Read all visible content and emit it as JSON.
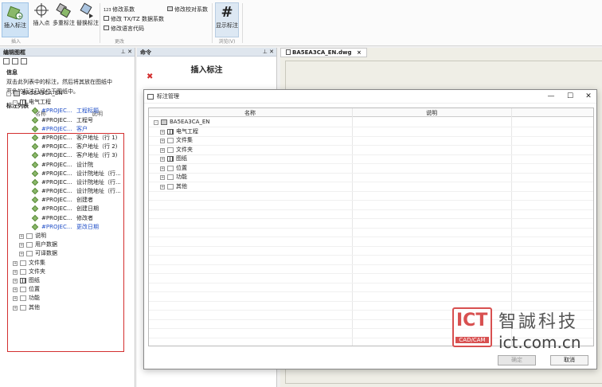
{
  "ribbon": {
    "insert_group": {
      "buttons": [
        {
          "label": "插入标注",
          "icon": "insert-tag-icon"
        },
        {
          "label": "插入点",
          "icon": "crosshair-icon"
        },
        {
          "label": "多重标注",
          "icon": "multi-tag-icon"
        },
        {
          "label": "替换标注",
          "icon": "replace-tag-icon"
        }
      ],
      "group_label": "插入"
    },
    "modify_group": {
      "items": [
        "修改系数",
        "修改 TX/TZ 数据系数",
        "修改语言代码",
        "修改校对系数"
      ],
      "group_label": "更改"
    },
    "browse_group": {
      "button_label": "显示标注",
      "group_label": "浏览(V)"
    }
  },
  "left_panel": {
    "title": "编辑图框",
    "info_title": "信息",
    "info_lines": [
      "双击此列表中的标注，然后将其放在图纸中",
      "蓝色的标注已经位于图纸中。"
    ],
    "list_title": "标注列表",
    "columns": {
      "name": "名称",
      "desc": "说明"
    },
    "tree": [
      {
        "label": "BA5EA3CA_EN",
        "depth": 0,
        "icon": "db",
        "expand": "-"
      },
      {
        "label": "电气工程",
        "depth": 1,
        "icon": "grid",
        "expand": "-"
      },
      {
        "label": "#PROJEC...",
        "desc": "工程标题",
        "depth": 3,
        "icon": "tag",
        "blue": true
      },
      {
        "label": "#PROJEC...",
        "desc": "工程号",
        "depth": 3,
        "icon": "tag"
      },
      {
        "label": "#PROJEC...",
        "desc": "客户",
        "depth": 3,
        "icon": "tag",
        "blue": true
      },
      {
        "label": "#PROJEC...",
        "desc": "客户地址（行 1)",
        "depth": 3,
        "icon": "tag"
      },
      {
        "label": "#PROJEC...",
        "desc": "客户地址（行 2)",
        "depth": 3,
        "icon": "tag"
      },
      {
        "label": "#PROJEC...",
        "desc": "客户地址（行 3)",
        "depth": 3,
        "icon": "tag"
      },
      {
        "label": "#PROJEC...",
        "desc": "设计院",
        "depth": 3,
        "icon": "tag"
      },
      {
        "label": "#PROJEC...",
        "desc": "设计院地址（行...",
        "depth": 3,
        "icon": "tag"
      },
      {
        "label": "#PROJEC...",
        "desc": "设计院地址（行...",
        "depth": 3,
        "icon": "tag"
      },
      {
        "label": "#PROJEC...",
        "desc": "设计院地址（行...",
        "depth": 3,
        "icon": "tag"
      },
      {
        "label": "#PROJEC...",
        "desc": "创建者",
        "depth": 3,
        "icon": "tag"
      },
      {
        "label": "#PROJEC...",
        "desc": "创建日期",
        "depth": 3,
        "icon": "tag"
      },
      {
        "label": "#PROJEC...",
        "desc": "修改者",
        "depth": 3,
        "icon": "tag"
      },
      {
        "label": "#PROJEC...",
        "desc": "更改日期",
        "depth": 3,
        "icon": "tag",
        "blue": true
      },
      {
        "label": "说明",
        "depth": 2,
        "icon": "folder",
        "expand": "+"
      },
      {
        "label": "用户数据",
        "depth": 2,
        "icon": "folder",
        "expand": "+"
      },
      {
        "label": "可译数据",
        "depth": 2,
        "icon": "folder",
        "expand": "+"
      },
      {
        "label": "文件集",
        "depth": 1,
        "icon": "folder",
        "expand": "+"
      },
      {
        "label": "文件夹",
        "depth": 1,
        "icon": "folder",
        "expand": "+"
      },
      {
        "label": "图纸",
        "depth": 1,
        "icon": "grid",
        "expand": "+"
      },
      {
        "label": "位置",
        "depth": 1,
        "icon": "folder",
        "expand": "+"
      },
      {
        "label": "功能",
        "depth": 1,
        "icon": "folder",
        "expand": "+"
      },
      {
        "label": "其他",
        "depth": 1,
        "icon": "folder",
        "expand": "+"
      }
    ]
  },
  "command_panel": {
    "title": "命令",
    "heading": "插入标注"
  },
  "drawing": {
    "tab_label": "BA5EA3CA_EN.dwg",
    "close_glyph": "×"
  },
  "dialog": {
    "title": "标注管理",
    "columns": {
      "name": "名称",
      "desc": "说明"
    },
    "tree": [
      {
        "label": "BA5EA3CA_EN",
        "depth": 0,
        "icon": "db",
        "expand": "-"
      },
      {
        "label": "电气工程",
        "depth": 1,
        "icon": "grid",
        "expand": "+"
      },
      {
        "label": "文件集",
        "depth": 1,
        "icon": "folder",
        "expand": "+"
      },
      {
        "label": "文件夹",
        "depth": 1,
        "icon": "folder",
        "expand": "+"
      },
      {
        "label": "图纸",
        "depth": 1,
        "icon": "grid",
        "expand": "+"
      },
      {
        "label": "位置",
        "depth": 1,
        "icon": "folder",
        "expand": "+"
      },
      {
        "label": "功能",
        "depth": 1,
        "icon": "folder",
        "expand": "+"
      },
      {
        "label": "其他",
        "depth": 1,
        "icon": "folder",
        "expand": "+"
      }
    ],
    "ok_label": "确定",
    "cancel_label": "取消"
  },
  "watermark": {
    "logo_text": "ICT",
    "logo_sub": "CAD/CAM",
    "name_cn": "智誠科技",
    "url": "ict.com.cn"
  },
  "colors": {
    "accent_red": "#d32f2f",
    "link_blue": "#2250c8"
  }
}
